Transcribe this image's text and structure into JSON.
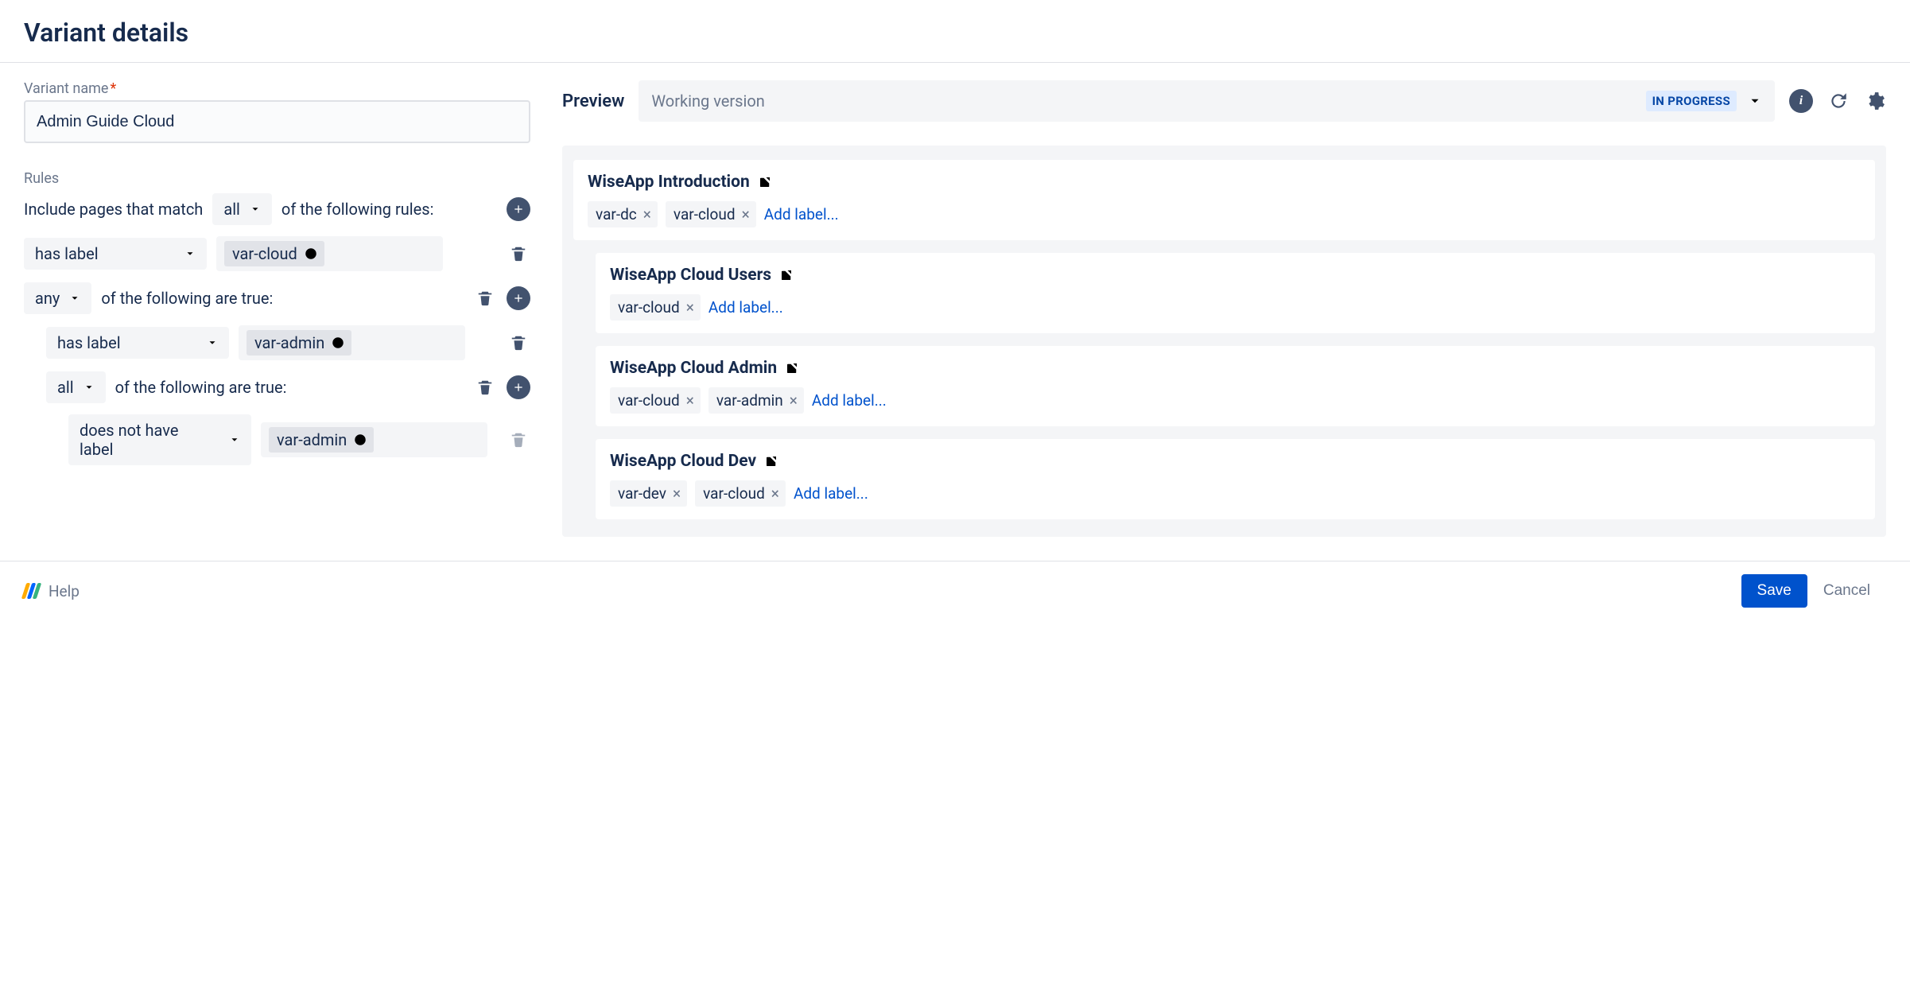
{
  "header": {
    "title": "Variant details"
  },
  "form": {
    "name_label": "Variant name",
    "name_value": "Admin Guide Cloud",
    "rules_label": "Rules",
    "include_prefix": "Include pages that match",
    "include_suffix": "of the following rules:",
    "match_mode": "all",
    "group_suffix": "of the following are true:",
    "rules": [
      {
        "op": "has label",
        "value": "var-cloud"
      },
      {
        "group_mode": "any",
        "children": [
          {
            "op": "has label",
            "value": "var-admin"
          },
          {
            "group_mode": "all",
            "children": [
              {
                "op": "does not have label",
                "value": "var-admin"
              }
            ]
          }
        ]
      }
    ]
  },
  "preview": {
    "title": "Preview",
    "version_label": "Working version",
    "status": "IN PROGRESS",
    "add_label_text": "Add label...",
    "pages": [
      {
        "title": "WiseApp Introduction",
        "indent": 0,
        "labels": [
          "var-dc",
          "var-cloud"
        ]
      },
      {
        "title": "WiseApp Cloud Users",
        "indent": 1,
        "labels": [
          "var-cloud"
        ]
      },
      {
        "title": "WiseApp Cloud Admin",
        "indent": 1,
        "labels": [
          "var-cloud",
          "var-admin"
        ]
      },
      {
        "title": "WiseApp Cloud Dev",
        "indent": 1,
        "labels": [
          "var-dev",
          "var-cloud"
        ]
      }
    ]
  },
  "footer": {
    "help": "Help",
    "save": "Save",
    "cancel": "Cancel"
  }
}
